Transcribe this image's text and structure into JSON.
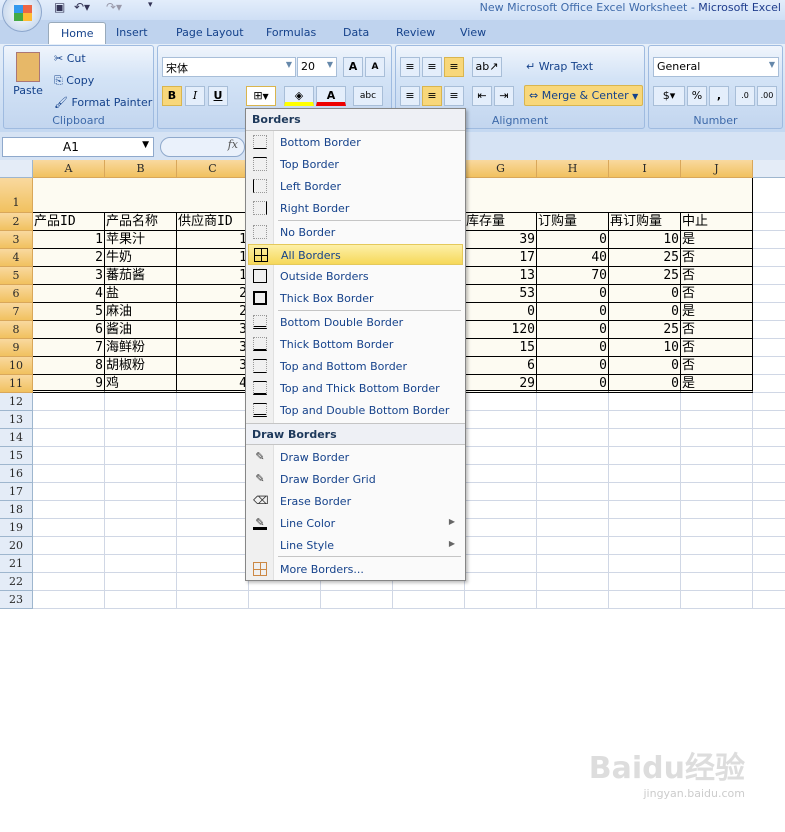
{
  "window": {
    "title_doc": "New Microsoft Office Excel Worksheet - ",
    "title_app": "Microsoft Excel"
  },
  "qat": {
    "icons": [
      "save-icon",
      "undo-icon",
      "redo-icon",
      "customize-icon"
    ]
  },
  "tabs": [
    "Home",
    "Insert",
    "Page Layout",
    "Formulas",
    "Data",
    "Review",
    "View"
  ],
  "active_tab": "Home",
  "clipboard": {
    "paste": "Paste",
    "cut": "Cut",
    "copy": "Copy",
    "format_painter": "Format Painter",
    "label": "Clipboard"
  },
  "font": {
    "name": "宋体",
    "size": "20",
    "bold": "B",
    "italic": "I",
    "underline": "U",
    "label": "Font"
  },
  "alignment": {
    "wrap": "Wrap Text",
    "merge": "Merge & Center",
    "label": "Alignment"
  },
  "number": {
    "format": "General",
    "percent": "%",
    "comma": ",",
    "label": "Number"
  },
  "formula_bar": {
    "name_box": "A1",
    "fx": "fx",
    "value": ""
  },
  "columns": [
    "A",
    "B",
    "C",
    "D",
    "E",
    "F",
    "G",
    "H",
    "I",
    "J"
  ],
  "rows": [
    "1",
    "2",
    "3",
    "4",
    "5",
    "6",
    "7",
    "8",
    "9",
    "10",
    "11",
    "12",
    "13",
    "14",
    "15",
    "16",
    "17",
    "18",
    "19",
    "20",
    "21",
    "22",
    "23"
  ],
  "table": {
    "headers": {
      "A": "产品ID",
      "B": "产品名称",
      "C": "供应商ID",
      "G": "库存量",
      "H": "订购量",
      "I": "再订购量",
      "J": "中止"
    },
    "data": [
      {
        "A": "1",
        "B": "苹果汁",
        "C": "1",
        "G": "39",
        "H": "0",
        "I": "10",
        "J": "是"
      },
      {
        "A": "2",
        "B": "牛奶",
        "C": "1",
        "G": "17",
        "H": "40",
        "I": "25",
        "J": "否"
      },
      {
        "A": "3",
        "B": "蕃茄酱",
        "C": "1",
        "G": "13",
        "H": "70",
        "I": "25",
        "J": "否"
      },
      {
        "A": "4",
        "B": "盐",
        "C": "2",
        "G": "53",
        "H": "0",
        "I": "0",
        "J": "否"
      },
      {
        "A": "5",
        "B": "麻油",
        "C": "2",
        "G": "0",
        "H": "0",
        "I": "0",
        "J": "是"
      },
      {
        "A": "6",
        "B": "酱油",
        "C": "3",
        "G": "120",
        "H": "0",
        "I": "25",
        "J": "否"
      },
      {
        "A": "7",
        "B": "海鲜粉",
        "C": "3",
        "G": "15",
        "H": "0",
        "I": "10",
        "J": "否"
      },
      {
        "A": "8",
        "B": "胡椒粉",
        "C": "3",
        "G": "6",
        "H": "0",
        "I": "0",
        "J": "否"
      },
      {
        "A": "9",
        "B": "鸡",
        "C": "4",
        "G": "29",
        "H": "0",
        "I": "0",
        "J": "是"
      }
    ]
  },
  "borders_menu": {
    "header": "Borders",
    "items": [
      {
        "label": "Bottom Border",
        "icon": "bottom-border-icon"
      },
      {
        "label": "Top Border",
        "icon": "top-border-icon"
      },
      {
        "label": "Left Border",
        "icon": "left-border-icon"
      },
      {
        "label": "Right Border",
        "icon": "right-border-icon"
      },
      {
        "label": "No Border",
        "icon": "no-border-icon"
      },
      {
        "label": "All Borders",
        "icon": "all-borders-icon",
        "selected": true
      },
      {
        "label": "Outside Borders",
        "icon": "outside-borders-icon"
      },
      {
        "label": "Thick Box Border",
        "icon": "thick-box-border-icon"
      },
      {
        "label": "Bottom Double Border",
        "icon": "bottom-double-border-icon"
      },
      {
        "label": "Thick Bottom Border",
        "icon": "thick-bottom-border-icon"
      },
      {
        "label": "Top and Bottom Border",
        "icon": "top-bottom-border-icon"
      },
      {
        "label": "Top and Thick Bottom Border",
        "icon": "top-thick-bottom-border-icon"
      },
      {
        "label": "Top and Double Bottom Border",
        "icon": "top-double-bottom-border-icon"
      }
    ],
    "draw_header": "Draw Borders",
    "draw_items": [
      {
        "label": "Draw Border",
        "icon": "draw-border-icon"
      },
      {
        "label": "Draw Border Grid",
        "icon": "draw-border-grid-icon"
      },
      {
        "label": "Erase Border",
        "icon": "eraser-icon"
      },
      {
        "label": "Line Color",
        "icon": "line-color-icon",
        "submenu": true
      },
      {
        "label": "Line Style",
        "icon": "line-style-icon",
        "submenu": true
      }
    ],
    "more": {
      "label": "More Borders...",
      "icon": "more-borders-icon"
    }
  },
  "watermark": {
    "brand": "Baidu经验",
    "url": "jingyan.baidu.com"
  }
}
